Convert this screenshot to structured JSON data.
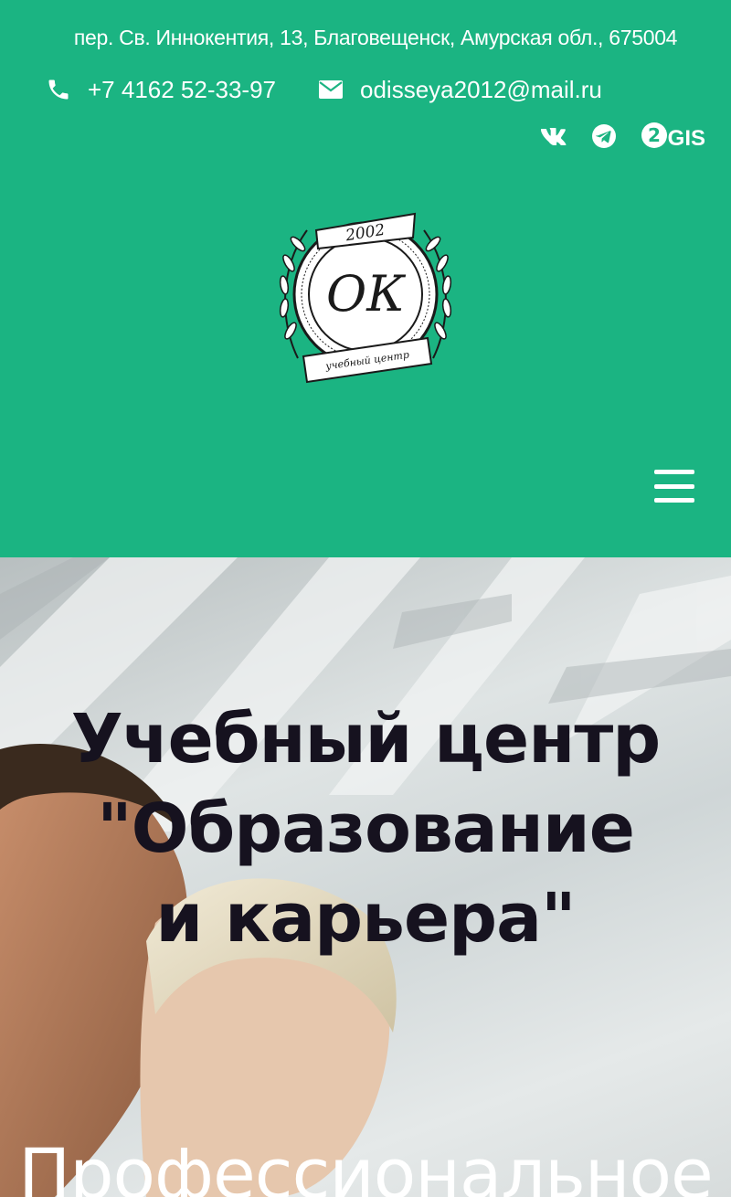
{
  "header": {
    "address": "пер. Св. Иннокентия, 13, Благовещенск, Амурская обл., 675004",
    "phone": "+7 4162 52-33-97",
    "email": "odisseya2012@mail.ru",
    "socials": {
      "vk_icon": "vk-icon",
      "telegram_icon": "telegram-icon",
      "gis_label": "GIS"
    },
    "logo": {
      "year": "2002",
      "monogram": "ОК",
      "ribbon_text": "учебный центр"
    },
    "menu_icon": "hamburger-menu-icon"
  },
  "hero": {
    "title_lines": [
      "Учебный центр",
      "\"Образование",
      "и карьера\""
    ],
    "subtitle": "Профессиональное"
  },
  "colors": {
    "brand_green": "#1bb482",
    "title_dark": "#16121f",
    "white": "#ffffff"
  }
}
